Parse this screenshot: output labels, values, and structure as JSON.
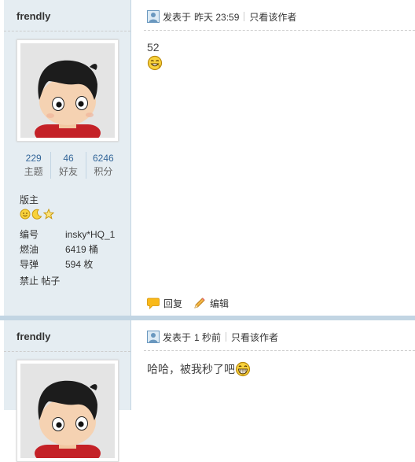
{
  "posts": [
    {
      "author": "frendly",
      "stats": [
        {
          "value": "229",
          "label": "主题"
        },
        {
          "value": "46",
          "label": "好友"
        },
        {
          "value": "6246",
          "label": "积分"
        }
      ],
      "rank": "版主",
      "info": [
        {
          "key": "编号",
          "value": "insky*HQ_1"
        },
        {
          "key": "燃油",
          "value": "6419 桶"
        },
        {
          "key": "导弹",
          "value": "594 枚"
        }
      ],
      "ban_label": "禁止 帖子",
      "posted_prefix": "发表于",
      "posted_time": "昨天 23:59",
      "author_only": "只看该作者",
      "content": "52",
      "reply_label": "回复",
      "edit_label": "编辑"
    },
    {
      "author": "frendly",
      "posted_prefix": "发表于",
      "posted_time": "1 秒前",
      "author_only": "只看该作者",
      "content": "哈哈，被我秒了吧"
    }
  ],
  "icons": {
    "post_icon": "user-post-icon",
    "reply_icon": "speech-bubble-icon",
    "edit_icon": "pencil-icon",
    "rank_icons": [
      "sun-icon",
      "moon-icon",
      "star-icon"
    ],
    "smileys": [
      "grin-wink-smiley-icon",
      "big-grin-smiley-icon"
    ]
  },
  "colors": {
    "sidebar_bg": "#E5EDF2",
    "border": "#C2D5E3",
    "link": "#336699",
    "reply_icon": "#F9B919",
    "edit_icon": "#E8A33A"
  }
}
